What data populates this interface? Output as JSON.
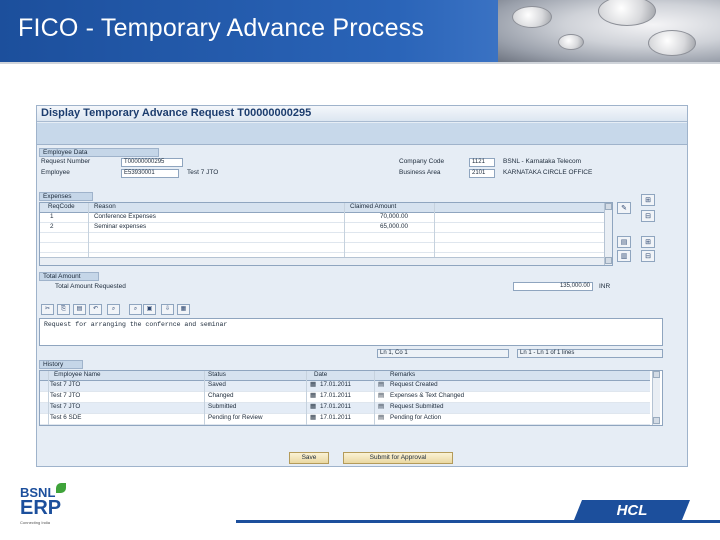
{
  "slide": {
    "title": "FICO - Temporary Advance Process"
  },
  "sap": {
    "window_title": "Display Temporary Advance Request T00000000295",
    "employee_group": "Employee Data",
    "request_number_label": "Request Number",
    "request_number_value": "T00000000295",
    "employee_label": "Employee",
    "employee_id": "E53930001",
    "employee_name": "Test 7 JTO",
    "company_code_label": "Company Code",
    "company_code_value": "1121",
    "company_code_text": "BSNL - Karnataka Telecom",
    "business_area_label": "Business Area",
    "business_area_value": "2101",
    "business_area_text": "KARNATAKA CIRCLE OFFICE",
    "expenses_group": "Expenses",
    "expenses_columns": [
      "ReqCode",
      "Reason",
      "Claimed Amount"
    ],
    "expenses_rows": [
      {
        "code": "1",
        "reason": "Conference Expenses",
        "amount": "70,000.00"
      },
      {
        "code": "2",
        "reason": "Seminar expenses",
        "amount": "65,000.00"
      }
    ],
    "total_group": "Total Amount",
    "total_label": "Total Amount Requested",
    "total_value": "135,000.00",
    "total_currency": "INR",
    "note_text": "Request for arranging the confernce and seminar",
    "note_position": "Ln 1, Co 1",
    "note_lines": "Ln 1 - Ln 1 of 1 lines",
    "history_group": "History",
    "history_columns": [
      "Employee Name",
      "Status",
      "Date",
      "Remarks"
    ],
    "history_rows": [
      {
        "name": "Test 7 JTO",
        "status": "Saved",
        "date": "17.01.2011",
        "remarks": "Request Created"
      },
      {
        "name": "Test 7 JTO",
        "status": "Changed",
        "date": "17.01.2011",
        "remarks": "Expenses & Text Changed"
      },
      {
        "name": "Test 7 JTO",
        "status": "Submitted",
        "date": "17.01.2011",
        "remarks": "Request Submitted"
      },
      {
        "name": "Test 6 SDE",
        "status": "Pending for Review",
        "date": "17.01.2011",
        "remarks": "Pending for Action"
      }
    ],
    "save_button": "Save",
    "submit_button": "Submit for Approval"
  },
  "footer": {
    "bsnl_brand": "BSNL",
    "erp_brand": "ERP",
    "bsnl_tagline": "Connecting India",
    "hcl_brand": "HCL"
  },
  "colors": {
    "header_blue": "#1c4f9c",
    "sap_background": "#e6edf5",
    "button_gold": "#ead8a2"
  }
}
